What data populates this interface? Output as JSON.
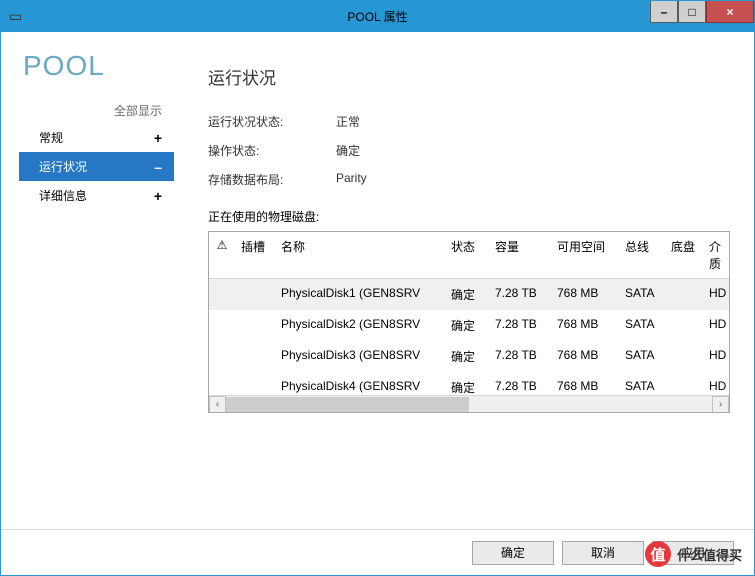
{
  "window": {
    "title": "POOL 属性",
    "minimize": "–",
    "maximize": "□",
    "close": "×"
  },
  "sidebar": {
    "pool_title": "POOL",
    "show_all": "全部显示",
    "items": [
      {
        "label": "常规",
        "expand": "+"
      },
      {
        "label": "运行状况",
        "expand": "–"
      },
      {
        "label": "详细信息",
        "expand": "+"
      }
    ]
  },
  "main": {
    "section_title": "运行状况",
    "rows": [
      {
        "label": "运行状况状态:",
        "value": "正常"
      },
      {
        "label": "操作状态:",
        "value": "确定"
      },
      {
        "label": "存储数据布局:",
        "value": "Parity"
      }
    ],
    "disks_label": "正在使用的物理磁盘:",
    "columns": {
      "warn": "⚠",
      "slot": "插槽",
      "name": "名称",
      "status": "状态",
      "capacity": "容量",
      "free": "可用空间",
      "bus": "总线",
      "chassis": "底盘",
      "media": "介质"
    },
    "disks": [
      {
        "name": "PhysicalDisk1 (GEN8SRV",
        "status": "确定",
        "capacity": "7.28 TB",
        "free": "768 MB",
        "bus": "SATA",
        "media": "HD"
      },
      {
        "name": "PhysicalDisk2 (GEN8SRV",
        "status": "确定",
        "capacity": "7.28 TB",
        "free": "768 MB",
        "bus": "SATA",
        "media": "HD"
      },
      {
        "name": "PhysicalDisk3 (GEN8SRV",
        "status": "确定",
        "capacity": "7.28 TB",
        "free": "768 MB",
        "bus": "SATA",
        "media": "HD"
      },
      {
        "name": "PhysicalDisk4 (GEN8SRV",
        "status": "确定",
        "capacity": "7.28 TB",
        "free": "768 MB",
        "bus": "SATA",
        "media": "HD"
      }
    ]
  },
  "footer": {
    "ok": "确定",
    "cancel": "取消",
    "apply": "应用"
  },
  "watermark": {
    "symbol": "值",
    "text": "什么值得买"
  }
}
